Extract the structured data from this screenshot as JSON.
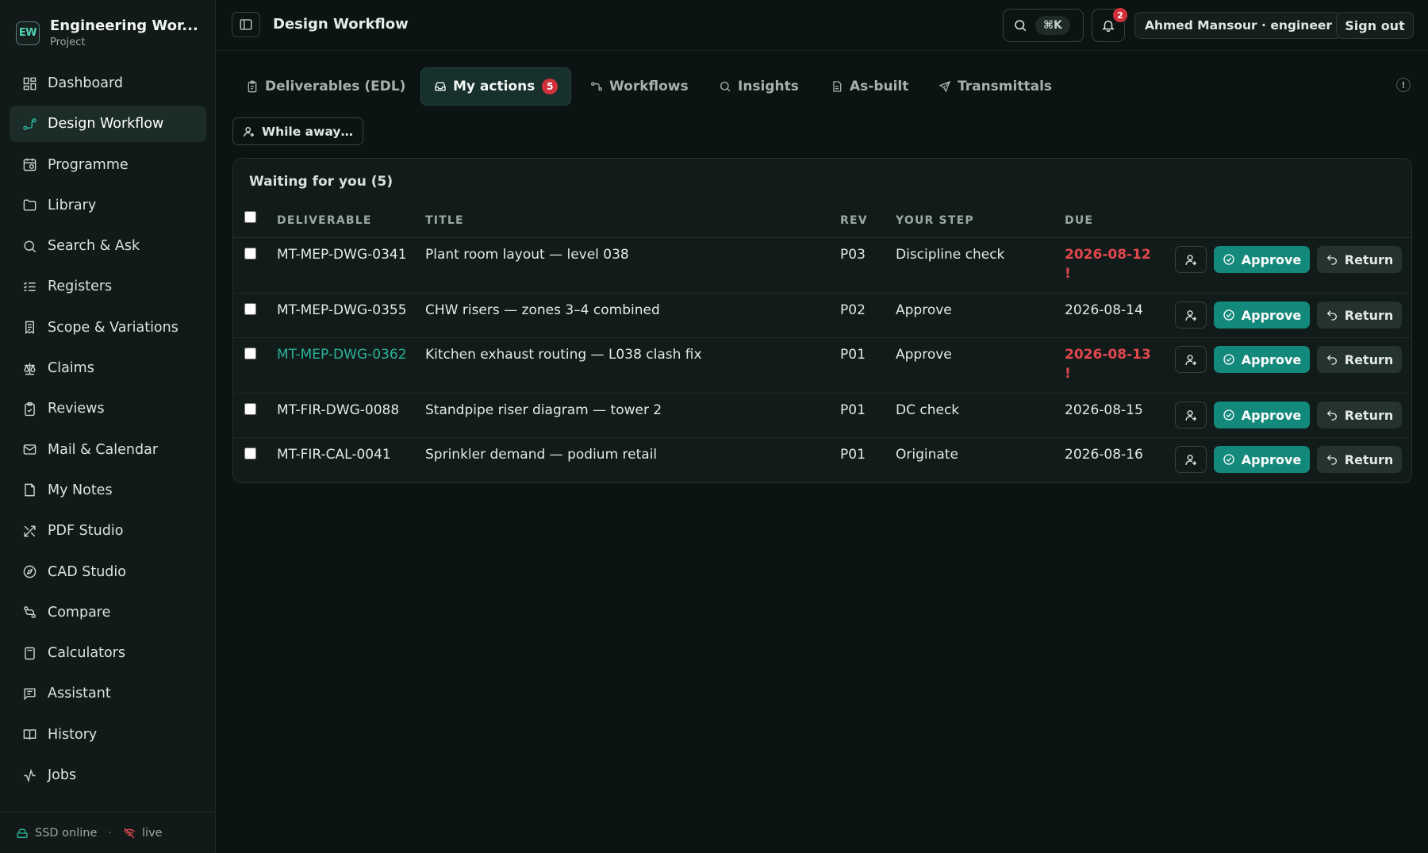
{
  "brand": {
    "logo": "EW",
    "title": "Engineering Wor...",
    "subtitle": "Project"
  },
  "sidebar": {
    "items": [
      {
        "label": "Dashboard",
        "icon": "dashboard-icon"
      },
      {
        "label": "Design Workflow",
        "icon": "workflow-icon",
        "active": true
      },
      {
        "label": "Programme",
        "icon": "calendar-clock-icon"
      },
      {
        "label": "Library",
        "icon": "folder-icon"
      },
      {
        "label": "Search & Ask",
        "icon": "search-icon"
      },
      {
        "label": "Registers",
        "icon": "list-check-icon"
      },
      {
        "label": "Scope & Variations",
        "icon": "receipt-icon"
      },
      {
        "label": "Claims",
        "icon": "scale-icon"
      },
      {
        "label": "Reviews",
        "icon": "clipboard-check-icon"
      },
      {
        "label": "Mail & Calendar",
        "icon": "mail-icon"
      },
      {
        "label": "My Notes",
        "icon": "note-icon"
      },
      {
        "label": "PDF Studio",
        "icon": "tools-icon"
      },
      {
        "label": "CAD Studio",
        "icon": "compass-icon"
      },
      {
        "label": "Compare",
        "icon": "git-compare-icon"
      },
      {
        "label": "Calculators",
        "icon": "calculator-icon"
      },
      {
        "label": "Assistant",
        "icon": "chat-icon"
      },
      {
        "label": "History",
        "icon": "book-icon"
      },
      {
        "label": "Jobs",
        "icon": "activity-icon"
      }
    ],
    "footer": {
      "storage": "SSD online",
      "separator": "·",
      "live": "live"
    }
  },
  "header": {
    "title": "Design Workflow",
    "search_shortcut": "⌘K",
    "notification_count": "2",
    "user": "Ahmed Mansour · engineer",
    "signout": "Sign out"
  },
  "tabs": [
    {
      "label": "Deliverables (EDL)",
      "icon": "clipboard-icon"
    },
    {
      "label": "My actions",
      "icon": "inbox-icon",
      "active": true,
      "badge": "5"
    },
    {
      "label": "Workflows",
      "icon": "workflow-icon"
    },
    {
      "label": "Insights",
      "icon": "search-icon"
    },
    {
      "label": "As-built",
      "icon": "file-icon"
    },
    {
      "label": "Transmittals",
      "icon": "send-icon"
    }
  ],
  "info_label": "!",
  "away_button": "While away…",
  "panel": {
    "title": "Waiting for you (5)",
    "columns": {
      "deliverable": "DELIVERABLE",
      "title": "TITLE",
      "rev": "REV",
      "step": "YOUR STEP",
      "due": "DUE"
    },
    "approve_label": "Approve",
    "return_label": "Return",
    "rows": [
      {
        "deliverable": "MT-MEP-DWG-0341",
        "title": "Plant room layout — level 038",
        "rev": "P03",
        "step": "Discipline check",
        "due": "2026-08-12 !",
        "overdue": true,
        "link": false
      },
      {
        "deliverable": "MT-MEP-DWG-0355",
        "title": "CHW risers — zones 3–4 combined",
        "rev": "P02",
        "step": "Approve",
        "due": "2026-08-14",
        "overdue": false,
        "link": false
      },
      {
        "deliverable": "MT-MEP-DWG-0362",
        "title": "Kitchen exhaust routing — L038 clash fix",
        "rev": "P01",
        "step": "Approve",
        "due": "2026-08-13 !",
        "overdue": true,
        "link": true
      },
      {
        "deliverable": "MT-FIR-DWG-0088",
        "title": "Standpipe riser diagram — tower 2",
        "rev": "P01",
        "step": "DC check",
        "due": "2026-08-15",
        "overdue": false,
        "link": false
      },
      {
        "deliverable": "MT-FIR-CAL-0041",
        "title": "Sprinkler demand — podium retail",
        "rev": "P01",
        "step": "Originate",
        "due": "2026-08-16",
        "overdue": false,
        "link": false
      }
    ]
  },
  "colors": {
    "accent": "#13897b",
    "link": "#2ab39a",
    "danger": "#e2474f",
    "badge": "#d2313b"
  }
}
